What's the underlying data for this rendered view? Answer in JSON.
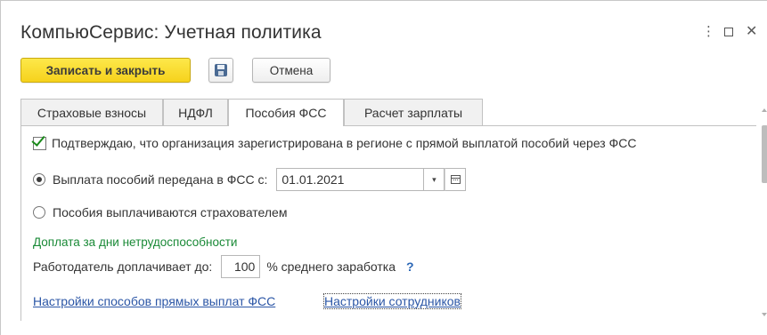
{
  "window": {
    "title": "КомпьюСервис: Учетная политика",
    "more_icon": "⋮",
    "close_icon": "✕"
  },
  "toolbar": {
    "save_close_label": "Записать и закрыть",
    "save_icon": "floppy-disk-icon",
    "cancel_label": "Отмена",
    "primary_color": "#f6d21c"
  },
  "tabs": [
    {
      "label": "Страховые взносы",
      "active": false
    },
    {
      "label": "НДФЛ",
      "active": false
    },
    {
      "label": "Пособия ФСС",
      "active": true
    },
    {
      "label": "Расчет зарплаты",
      "active": false
    }
  ],
  "form": {
    "confirm_checkbox": {
      "label": "Подтверждаю, что организация зарегистрирована в регионе с прямой выплатой пособий через ФСС",
      "checked": true
    },
    "radio_fss": {
      "label": "Выплата пособий передана в ФСС с:",
      "selected": true,
      "date_value": "01.01.2021",
      "dropdown_glyph": "▾"
    },
    "radio_insurer": {
      "label": "Пособия выплачиваются страхователем",
      "selected": false
    },
    "section_title": "Доплата за дни нетрудоспособности",
    "section_color": "#1a8a37",
    "employer_pays": {
      "label": "Работодатель доплачивает до:",
      "value": "100",
      "suffix": "% среднего заработка",
      "help": "?"
    },
    "links": {
      "direct_payments": "Настройки способов прямых выплат ФСС",
      "employees": "Настройки сотрудников"
    },
    "link_color": "#2b56a6"
  }
}
